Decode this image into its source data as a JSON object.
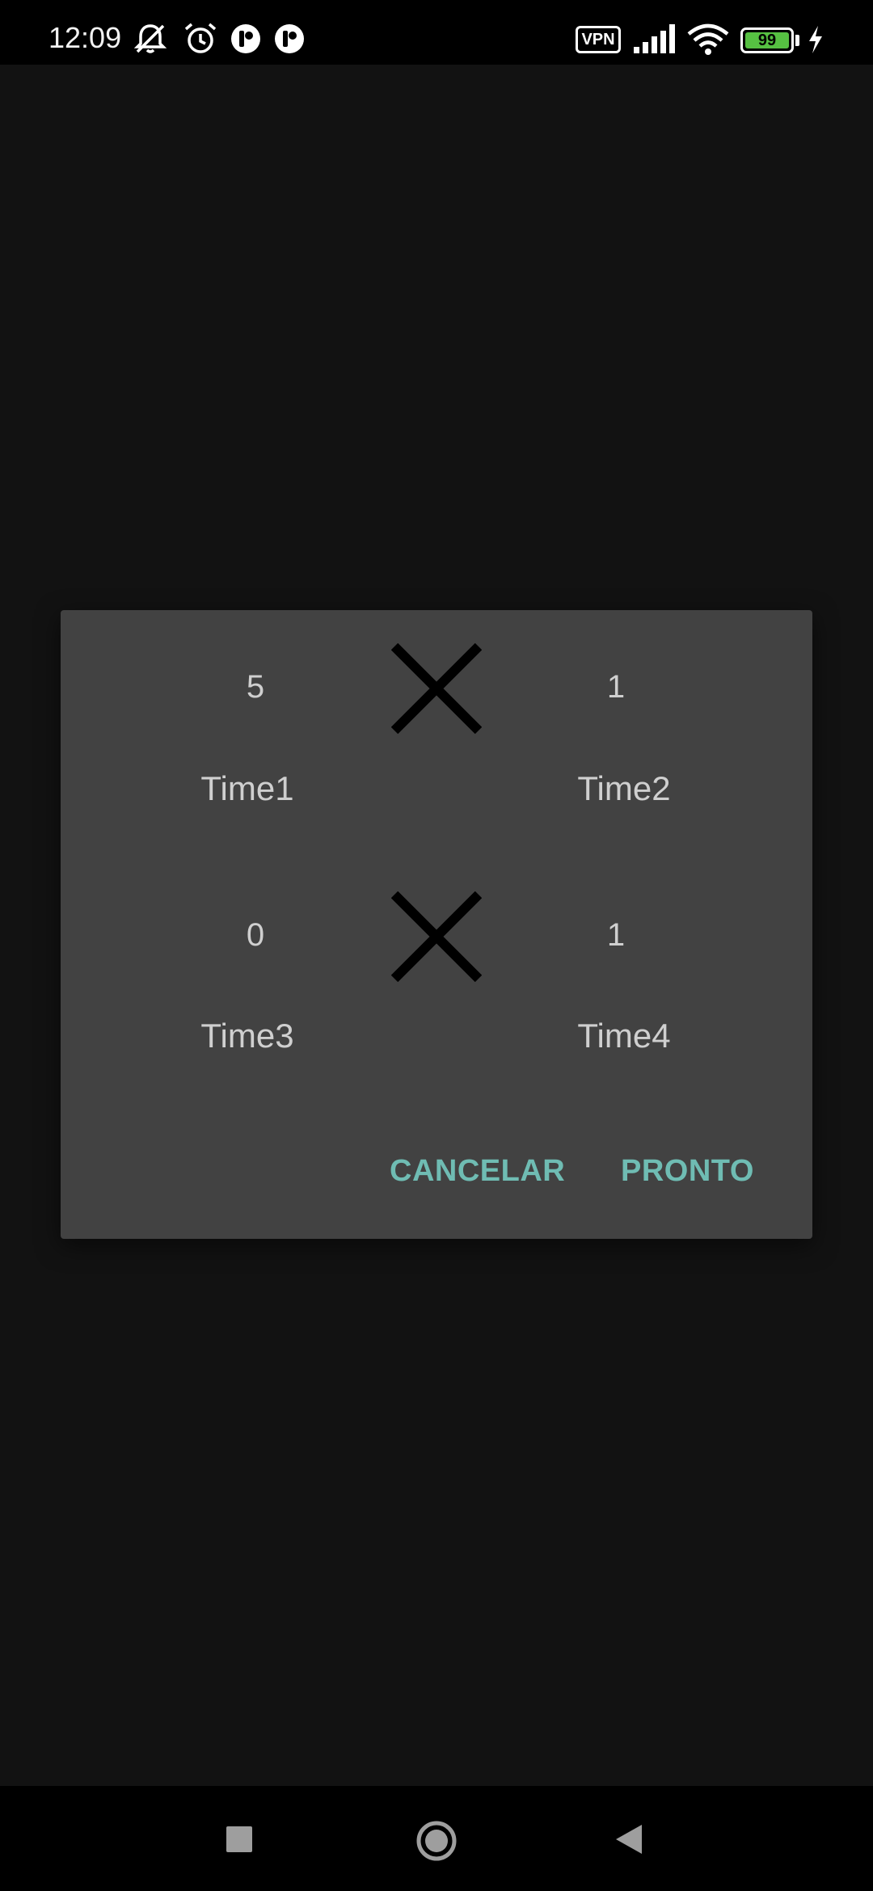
{
  "status_bar": {
    "time": "12:09",
    "vpn_label": "VPN",
    "battery_level": "99",
    "icons": [
      "notifications-off-icon",
      "alarm-icon",
      "app-notification-icon",
      "app-notification-icon",
      "vpn-icon",
      "signal-icon",
      "wifi-icon",
      "battery-icon",
      "charging-icon"
    ]
  },
  "dialog": {
    "match1": {
      "home_score": "5",
      "home_team": "Time1",
      "away_score": "1",
      "away_team": "Time2",
      "separator_icon": "close-x-icon"
    },
    "match2": {
      "home_score": "0",
      "home_team": "Time3",
      "away_score": "1",
      "away_team": "Time4",
      "separator_icon": "close-x-icon"
    },
    "cancel_label": "CANCELAR",
    "done_label": "PRONTO",
    "accent_color": "#6fbcb3"
  },
  "nav_bar": {
    "icons": [
      "recents-square-icon",
      "home-circle-icon",
      "back-triangle-icon"
    ]
  }
}
